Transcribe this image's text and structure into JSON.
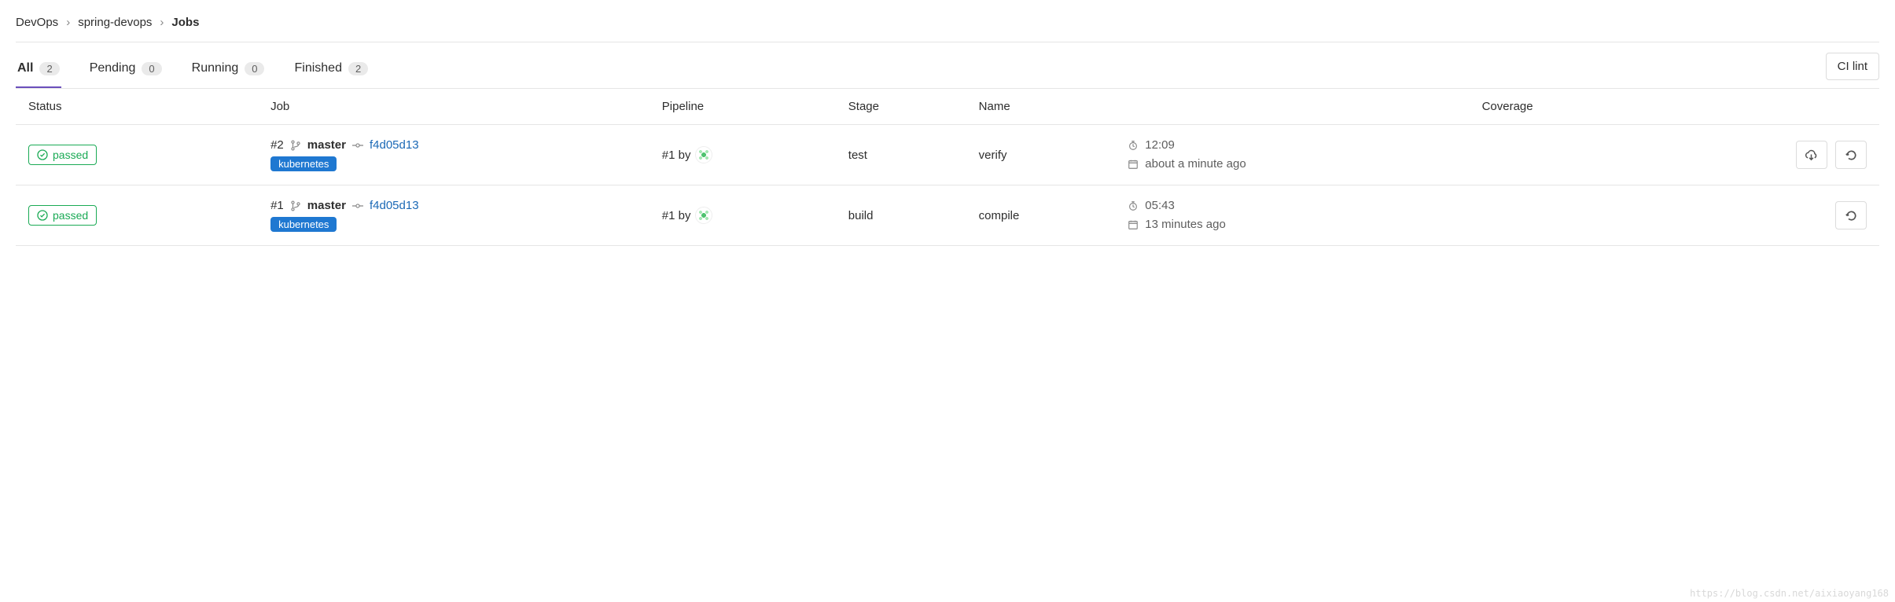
{
  "breadcrumb": {
    "root": "DevOps",
    "project": "spring-devops",
    "current": "Jobs"
  },
  "tabs": [
    {
      "label": "All",
      "count": "2",
      "active": true
    },
    {
      "label": "Pending",
      "count": "0",
      "active": false
    },
    {
      "label": "Running",
      "count": "0",
      "active": false
    },
    {
      "label": "Finished",
      "count": "2",
      "active": false
    }
  ],
  "ci_lint_label": "CI lint",
  "columns": {
    "status": "Status",
    "job": "Job",
    "pipeline": "Pipeline",
    "stage": "Stage",
    "name": "Name",
    "coverage": "Coverage"
  },
  "status_label": "passed",
  "jobs": [
    {
      "job_number": "#2",
      "branch": "master",
      "sha": "f4d05d13",
      "runner_tag": "kubernetes",
      "pipeline": "#1 by",
      "stage": "test",
      "name": "verify",
      "duration": "12:09",
      "finished": "about a minute ago",
      "has_download": true
    },
    {
      "job_number": "#1",
      "branch": "master",
      "sha": "f4d05d13",
      "runner_tag": "kubernetes",
      "pipeline": "#1 by",
      "stage": "build",
      "name": "compile",
      "duration": "05:43",
      "finished": "13 minutes ago",
      "has_download": false
    }
  ],
  "watermark": "https://blog.csdn.net/aixiaoyang168"
}
